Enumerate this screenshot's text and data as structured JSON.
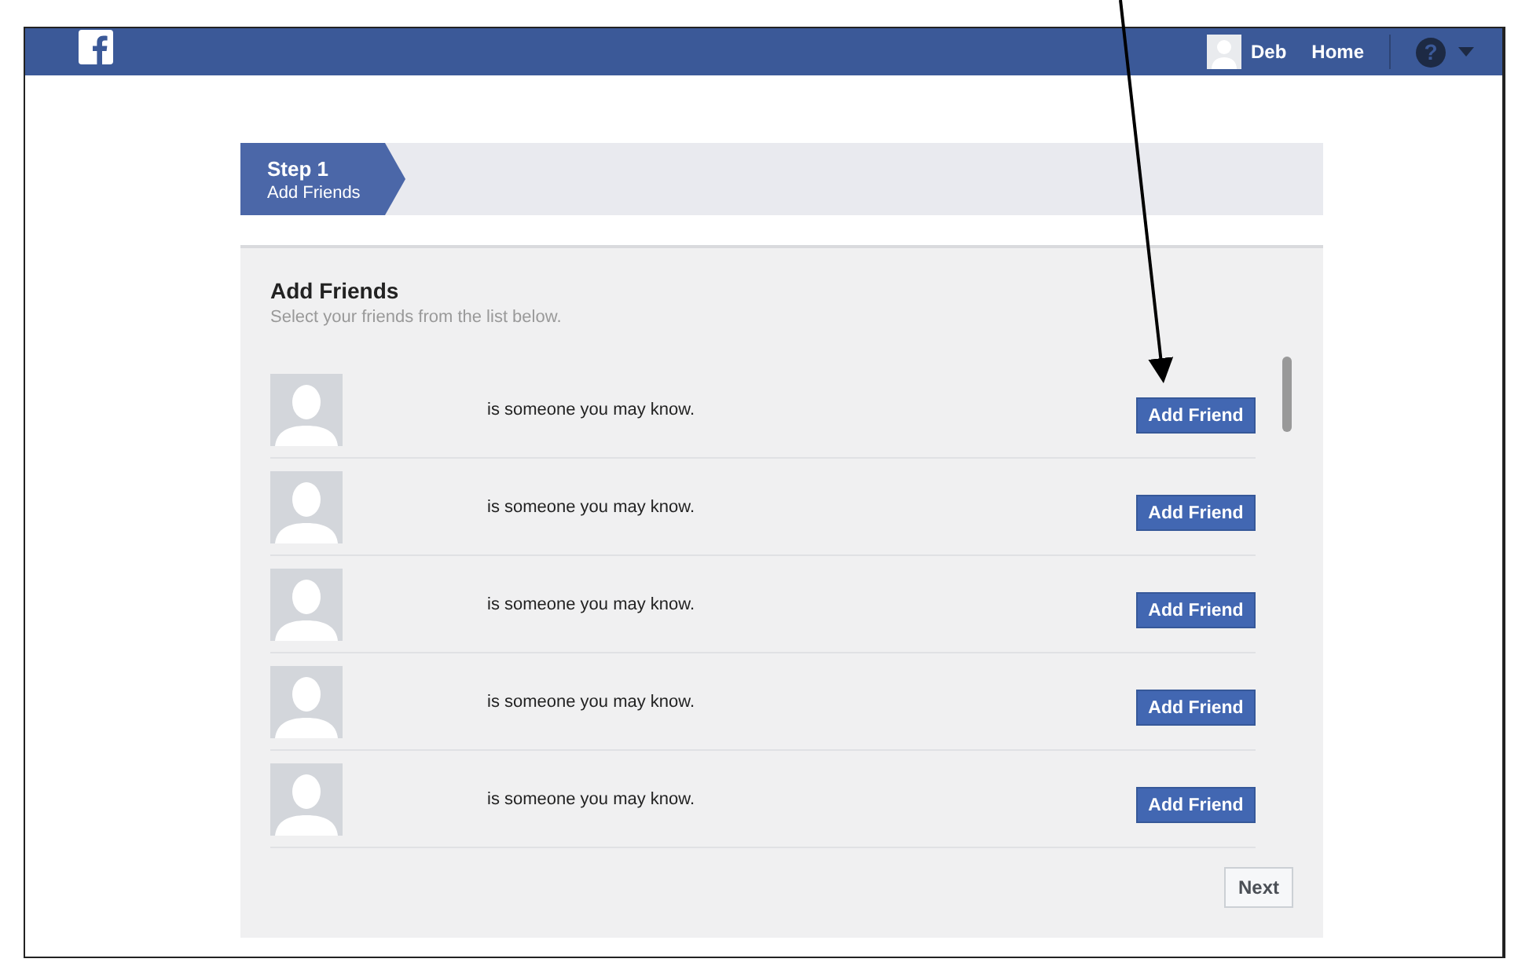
{
  "top_bar": {
    "user_name": "Deb",
    "home_link": "Home",
    "help_icon": "?"
  },
  "step": {
    "number": "Step 1",
    "label": "Add Friends"
  },
  "panel": {
    "title": "Add Friends",
    "subtitle": "Select your friends from the list below.",
    "suggestions": [
      {
        "text": "is someone you may know.",
        "button": "Add Friend"
      },
      {
        "text": "is someone you may know.",
        "button": "Add Friend"
      },
      {
        "text": "is someone you may know.",
        "button": "Add Friend"
      },
      {
        "text": "is someone you may know.",
        "button": "Add Friend"
      },
      {
        "text": "is someone you may know.",
        "button": "Add Friend"
      }
    ],
    "next_button": "Next"
  }
}
